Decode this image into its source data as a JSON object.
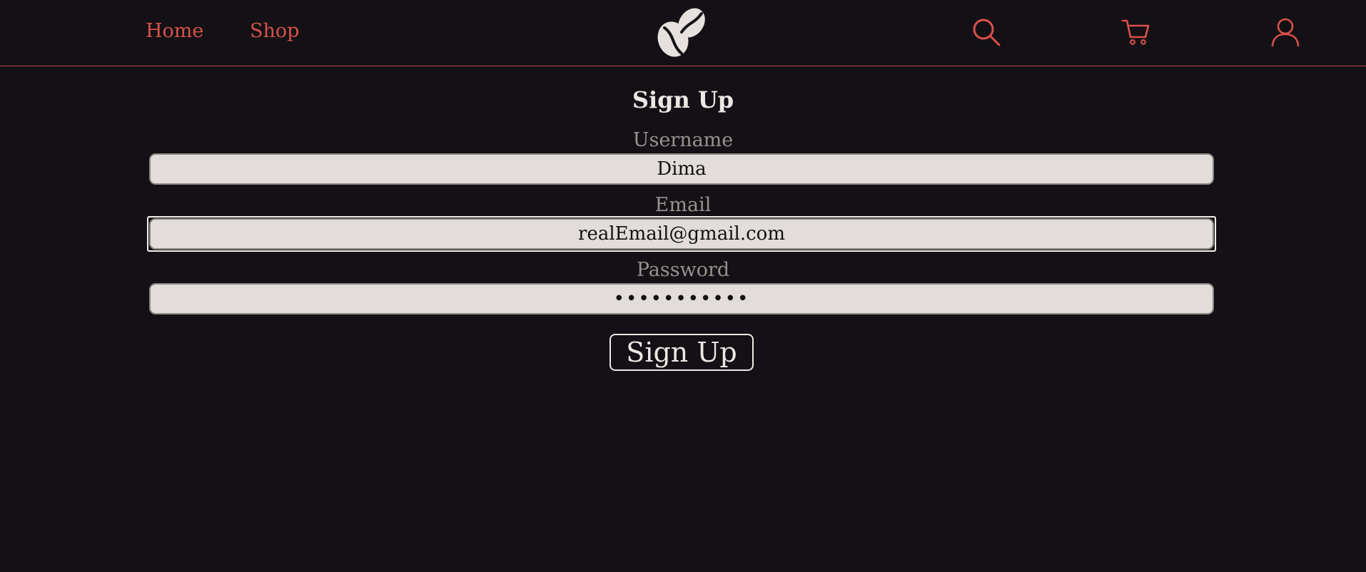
{
  "nav": {
    "home_label": "Home",
    "shop_label": "Shop"
  },
  "header_icons": [
    "coffee-beans-logo",
    "search-icon",
    "cart-icon",
    "user-icon"
  ],
  "colors": {
    "background": "#131115",
    "accent": "#d9514c",
    "field_bg": "#e2ddda",
    "label": "#9a918e",
    "text_light": "#ece7e4"
  },
  "form": {
    "title": "Sign Up",
    "username": {
      "label": "Username",
      "value": "Dima"
    },
    "email": {
      "label": "Email",
      "value": "realEmail@gmail.com"
    },
    "password": {
      "label": "Password",
      "value": "•••••••••••"
    },
    "submit_label": "Sign Up"
  }
}
